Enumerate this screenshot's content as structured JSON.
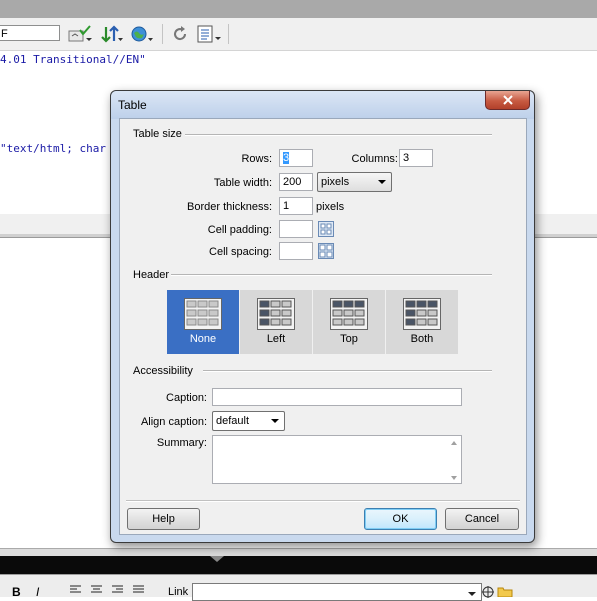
{
  "editor": {
    "toolbar_input_value": "F",
    "code_line_1": "4.01 Transitional//EN\"",
    "code_line_2": "\"text/html; char",
    "props_link_label": "Link",
    "props_bold": "B",
    "props_italic": "I"
  },
  "dialog": {
    "title": "Table",
    "table_size": {
      "legend": "Table size",
      "rows_label": "Rows:",
      "rows_value": "3",
      "columns_label": "Columns:",
      "columns_value": "3",
      "width_label": "Table width:",
      "width_value": "200",
      "width_unit": "pixels",
      "border_label": "Border thickness:",
      "border_value": "1",
      "border_unit": "pixels",
      "padding_label": "Cell padding:",
      "padding_value": "",
      "spacing_label": "Cell spacing:",
      "spacing_value": ""
    },
    "header": {
      "legend": "Header",
      "options": [
        {
          "label": "None",
          "selected": true
        },
        {
          "label": "Left",
          "selected": false
        },
        {
          "label": "Top",
          "selected": false
        },
        {
          "label": "Both",
          "selected": false
        }
      ]
    },
    "accessibility": {
      "legend": "Accessibility",
      "caption_label": "Caption:",
      "caption_value": "",
      "align_label": "Align caption:",
      "align_value": "default",
      "summary_label": "Summary:",
      "summary_value": ""
    },
    "buttons": {
      "help": "Help",
      "ok": "OK",
      "cancel": "Cancel"
    }
  },
  "colors": {
    "selected_header": "#3a6fc4",
    "code_text": "#1a1aa6",
    "close_button": "#c75a42"
  }
}
